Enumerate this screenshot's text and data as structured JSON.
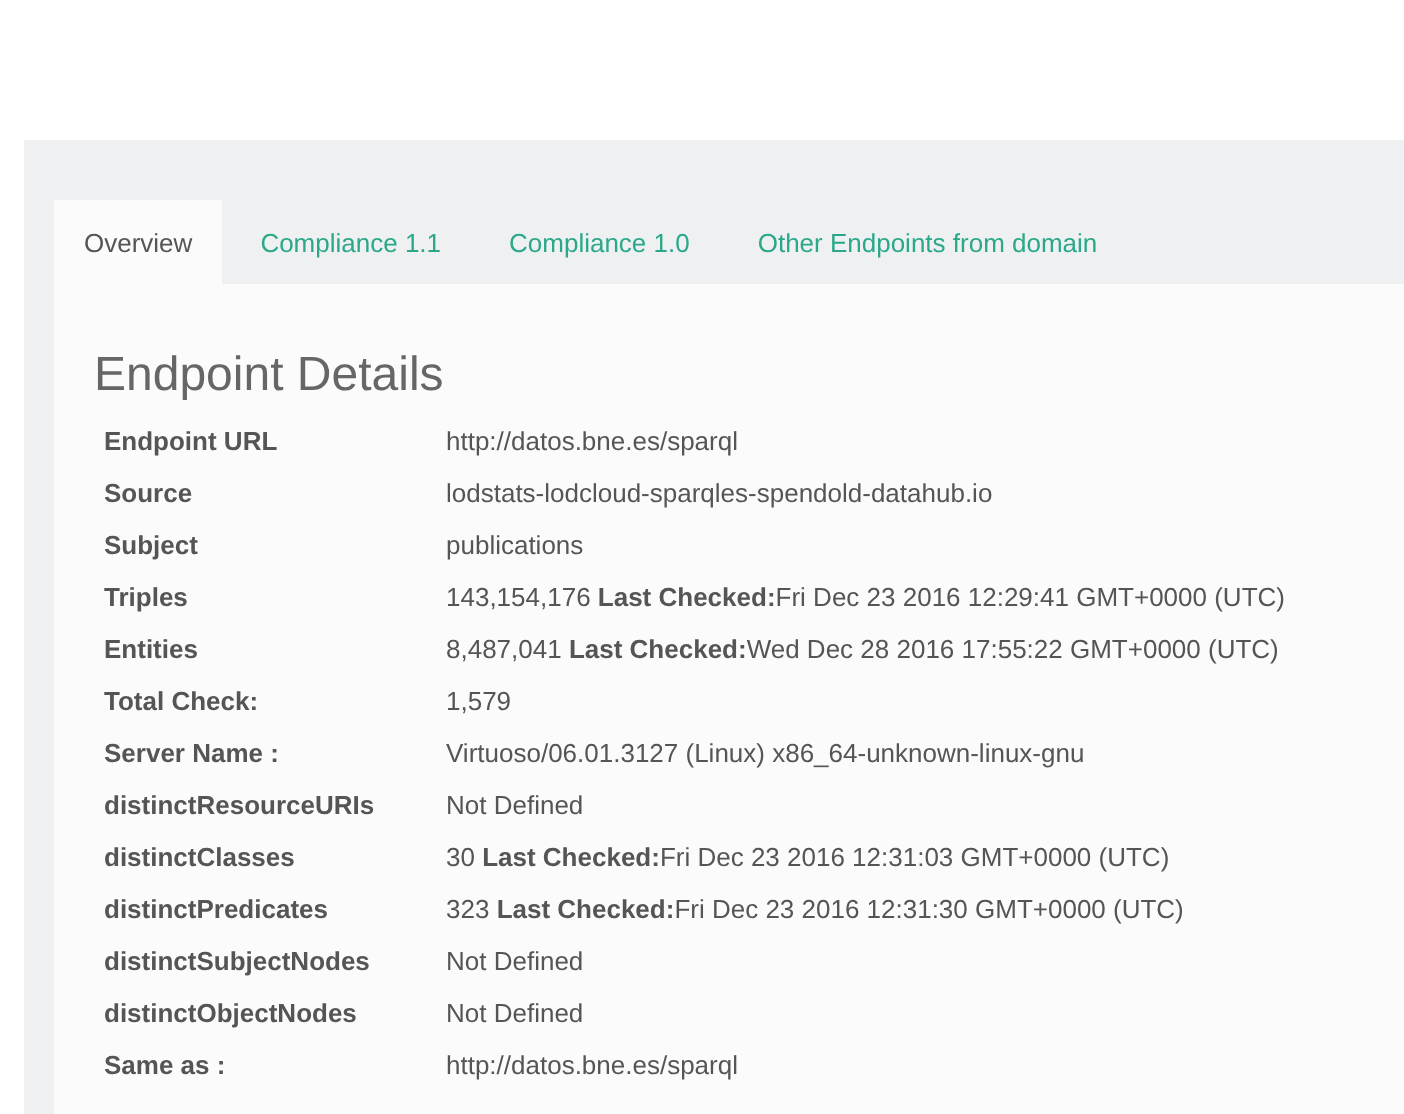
{
  "tabs": [
    {
      "label": "Overview",
      "selected": true
    },
    {
      "label": "Compliance 1.1",
      "selected": false
    },
    {
      "label": "Compliance 1.0",
      "selected": false
    },
    {
      "label": "Other Endpoints from domain",
      "selected": false
    }
  ],
  "heading": "Endpoint Details",
  "details": [
    {
      "label": "Endpoint URL",
      "value": "http://datos.bne.es/sparql"
    },
    {
      "label": "Source",
      "value": "lodstats-lodcloud-sparqles-spendold-datahub.io"
    },
    {
      "label": "Subject",
      "value": "publications"
    },
    {
      "label": "Triples",
      "value": "143,154,176 **Last Checked:**Fri Dec 23 2016 12:29:41 GMT+0000 (UTC)"
    },
    {
      "label": "Entities",
      "value": "8,487,041 **Last Checked:**Wed Dec 28 2016 17:55:22 GMT+0000 (UTC)"
    },
    {
      "label": "Total Check:",
      "value": "1,579"
    },
    {
      "label": "Server Name :",
      "value": "Virtuoso/06.01.3127 (Linux) x86_64-unknown-linux-gnu"
    },
    {
      "label": "distinctResourceURIs",
      "value": "Not Defined"
    },
    {
      "label": "distinctClasses",
      "value": "30 **Last Checked:**Fri Dec 23 2016 12:31:03 GMT+0000 (UTC)"
    },
    {
      "label": "distinctPredicates",
      "value": "323 **Last Checked:**Fri Dec 23 2016 12:31:30 GMT+0000 (UTC)"
    },
    {
      "label": "distinctSubjectNodes",
      "value": "Not Defined"
    },
    {
      "label": "distinctObjectNodes",
      "value": "Not Defined"
    },
    {
      "label": "Same as :",
      "value": "http://datos.bne.es/sparql"
    }
  ]
}
